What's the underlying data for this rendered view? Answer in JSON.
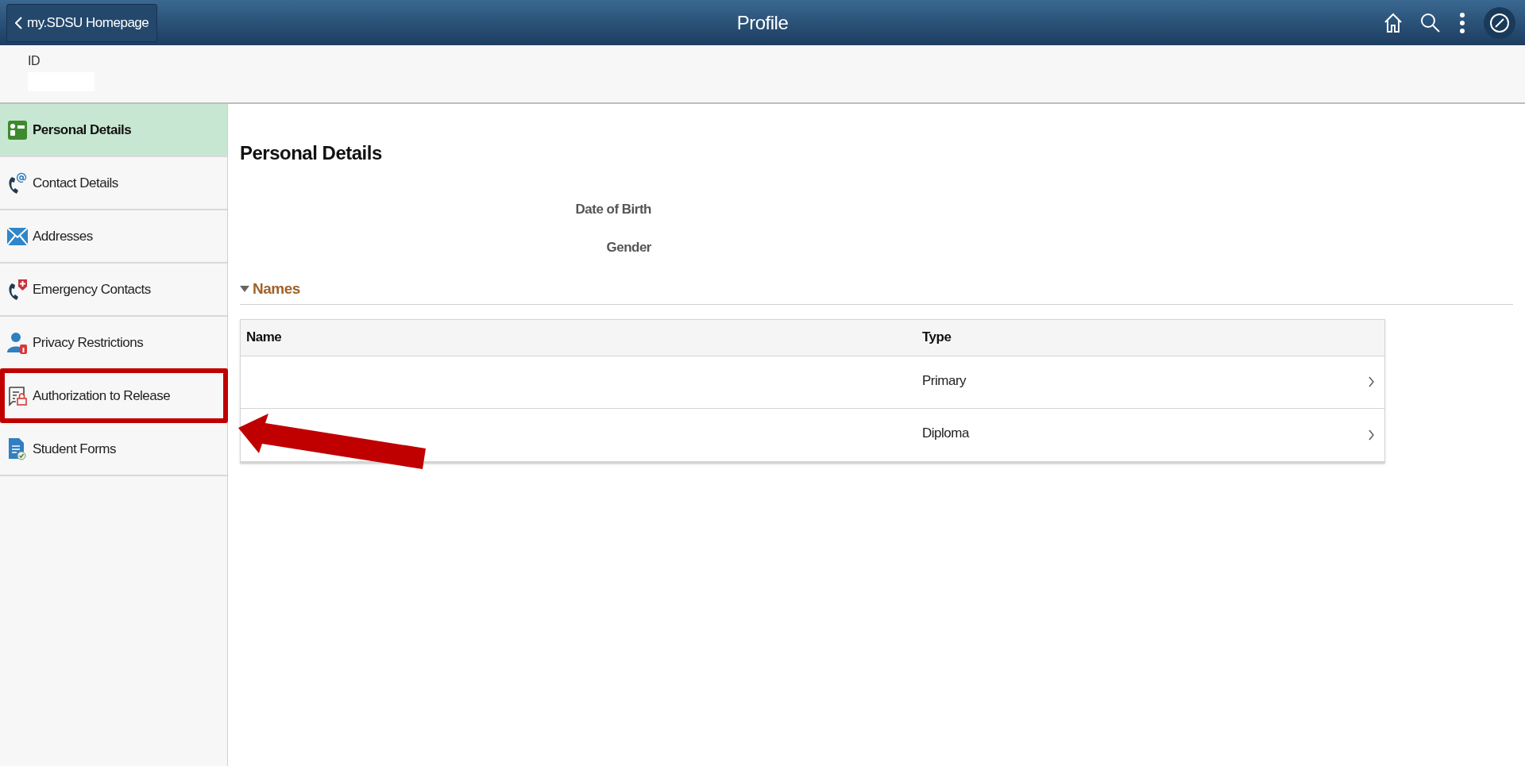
{
  "header": {
    "back_button": "my.SDSU Homepage",
    "title": "Profile"
  },
  "id_label": "ID",
  "sidebar": {
    "items": [
      {
        "label": "Personal Details",
        "selected": true,
        "highlighted": false
      },
      {
        "label": "Contact Details",
        "selected": false,
        "highlighted": false
      },
      {
        "label": "Addresses",
        "selected": false,
        "highlighted": false
      },
      {
        "label": "Emergency Contacts",
        "selected": false,
        "highlighted": false
      },
      {
        "label": "Privacy Restrictions",
        "selected": false,
        "highlighted": false
      },
      {
        "label": "Authorization to Release",
        "selected": false,
        "highlighted": true
      },
      {
        "label": "Student Forms",
        "selected": false,
        "highlighted": false
      }
    ]
  },
  "content": {
    "title": "Personal Details",
    "fields": [
      "Date of Birth",
      "Gender"
    ],
    "section": {
      "title": "Names",
      "expanded": true,
      "table": {
        "columns": [
          "Name",
          "Type"
        ],
        "rows": [
          {
            "type": "Primary"
          },
          {
            "type": "Diploma"
          }
        ]
      }
    }
  }
}
